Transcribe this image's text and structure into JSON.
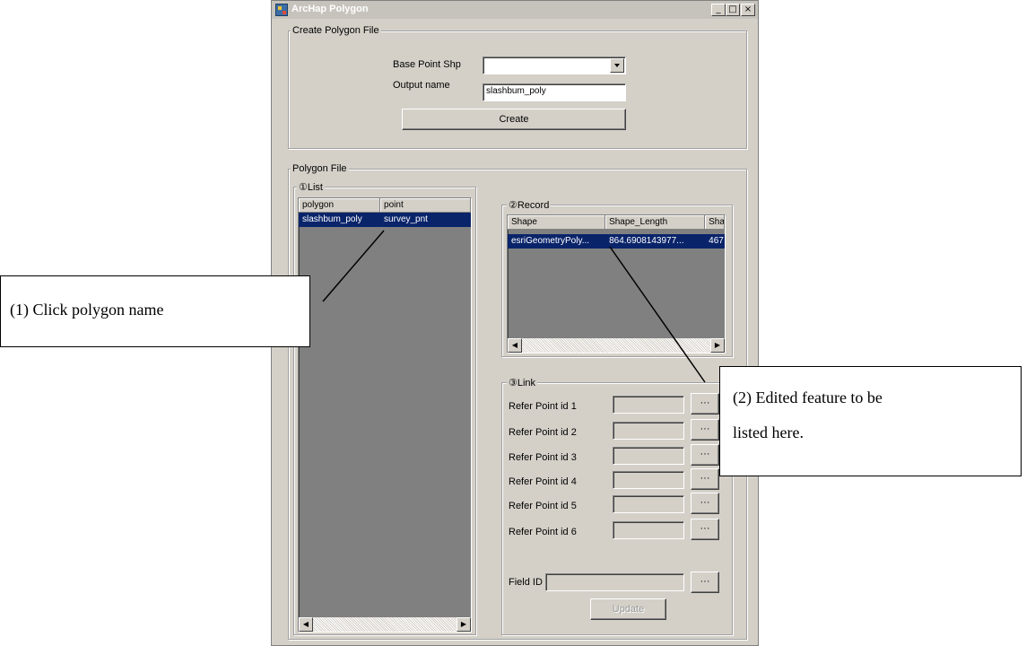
{
  "window": {
    "title": "ArcHap Polygon",
    "minimize": "_",
    "maximize": "□",
    "close": "×"
  },
  "create_group": {
    "legend": "Create Polygon File",
    "base_point_label": "Base Point Shp",
    "base_point_value": "",
    "output_label": "Output name",
    "output_value": "slashbum_poly",
    "create_button": "Create"
  },
  "polygon_group": {
    "legend": "Polygon File",
    "list": {
      "legend": "①List",
      "columns": [
        "polygon",
        "point"
      ],
      "rows": [
        [
          "slashbum_poly",
          "survey_pnt"
        ]
      ]
    },
    "record": {
      "legend": "②Record",
      "columns": [
        "Shape",
        "Shape_Length",
        "Sha"
      ],
      "rows": [
        [
          "esriGeometryPoly...",
          "864.6908143977...",
          "467"
        ]
      ]
    },
    "link": {
      "legend": "③Link",
      "refer_points": [
        "Refer Point id 1",
        "Refer Point id 2",
        "Refer Point id 3",
        "Refer Point id 4",
        "Refer Point id 5",
        "Refer Point id 6"
      ],
      "browse_label": "···",
      "field_id_label": "Field ID",
      "update_button": "Update"
    }
  },
  "callouts": {
    "c1": "(1) Click polygon name",
    "c2_line1": "(2) Edited feature to be",
    "c2_line2": "listed here."
  },
  "icons": {
    "dropdown": "dropdown-arrow-icon",
    "scroll_left": "scroll-left-icon",
    "scroll_right": "scroll-right-icon"
  }
}
